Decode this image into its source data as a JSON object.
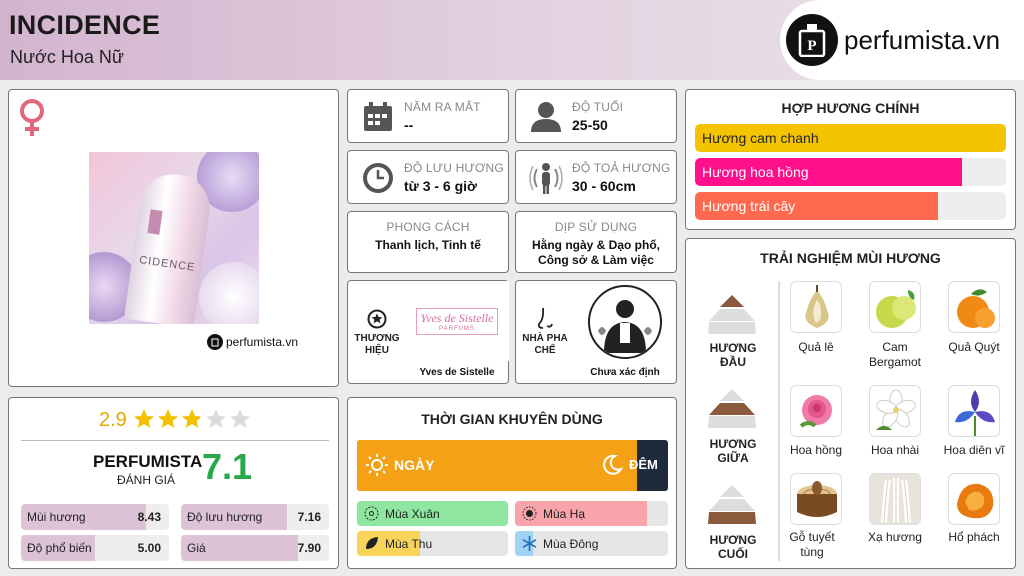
{
  "header": {
    "title": "INCIDENCE",
    "subtitle": "Nước Hoa Nữ",
    "logo_text": "perfumista.vn",
    "gender_icon": "female-symbol-icon"
  },
  "product": {
    "watermark": "perfumista.vn",
    "bottle_text": "CIDENCE"
  },
  "info": {
    "release": {
      "label": "NĂM RA MẮT",
      "value": "--"
    },
    "age": {
      "label": "ĐỘ TUỔI",
      "value": "25-50"
    },
    "longevity": {
      "label": "ĐỘ LƯU HƯƠNG",
      "value": "từ 3 - 6 giờ"
    },
    "sillage": {
      "label": "ĐỘ TOẢ HƯƠNG",
      "value": "30 - 60cm"
    },
    "style": {
      "label": "PHONG CÁCH",
      "value": "Thanh lịch, Tinh tế"
    },
    "occasion": {
      "label": "DỊP SỬ DỤNG",
      "value": "Hằng ngày & Dạo phố, Công sở & Làm việc"
    },
    "brand": {
      "label": "THƯƠNG HIỆU",
      "value": "Yves de Sistelle",
      "logo_line1": "Yves de Sistelle",
      "logo_line2": "PARFUMS"
    },
    "perfumer": {
      "label": "NHÀ PHA CHẾ",
      "value": "Chưa xác định"
    }
  },
  "rating": {
    "score": "2.9",
    "stars": 2.9,
    "brand": "PERFUMISTA",
    "subtitle": "ĐÁNH GIÁ",
    "overall": "7.1",
    "metrics": [
      {
        "label": "Mùi hương",
        "value": "8.43",
        "fraction": 0.843
      },
      {
        "label": "Độ lưu hương",
        "value": "7.16",
        "fraction": 0.716
      },
      {
        "label": "Độ phổ biến",
        "value": "5.00",
        "fraction": 0.5
      },
      {
        "label": "Giá",
        "value": "7.90",
        "fraction": 0.79
      }
    ]
  },
  "main_accords": {
    "title": "HỢP HƯƠNG CHÍNH",
    "items": [
      {
        "label": "Hương cam chanh",
        "fraction": 1.0,
        "color": "#f5c400"
      },
      {
        "label": "Hương hoa hồng",
        "fraction": 0.86,
        "color": "#ff0f8b"
      },
      {
        "label": "Hương trái cây",
        "fraction": 0.78,
        "color": "#ff6a4f"
      }
    ]
  },
  "time": {
    "title": "THỜI GIAN KHUYÊN DÙNG",
    "day": "NGÀY",
    "night": "ĐÊM",
    "day_fraction": 0.9,
    "seasons": [
      {
        "label": "Mùa Xuân",
        "fraction": 1.0,
        "color": "#8ee6a0"
      },
      {
        "label": "Mùa Hạ",
        "fraction": 0.86,
        "color": "#f9a3aa"
      },
      {
        "label": "Mùa Thu",
        "fraction": 0.42,
        "color": "#f8d55a"
      },
      {
        "label": "Mùa Đông",
        "fraction": 0.12,
        "color": "#9fd2f5"
      }
    ]
  },
  "notes": {
    "title": "TRẢI NGHIỆM MÙI HƯƠNG",
    "top": {
      "label": "HƯƠNG ĐẦU",
      "items": [
        "Quả lê",
        "Cam Bergamot",
        "Quả Quýt"
      ]
    },
    "middle": {
      "label": "HƯƠNG GIỮA",
      "items": [
        "Hoa hồng",
        "Hoa nhài",
        "Hoa diên vĩ"
      ]
    },
    "base": {
      "label": "HƯƠNG CUỐI",
      "items": [
        "Gỗ tuyết tùng",
        "Xạ hương",
        "Hổ phách"
      ]
    }
  }
}
